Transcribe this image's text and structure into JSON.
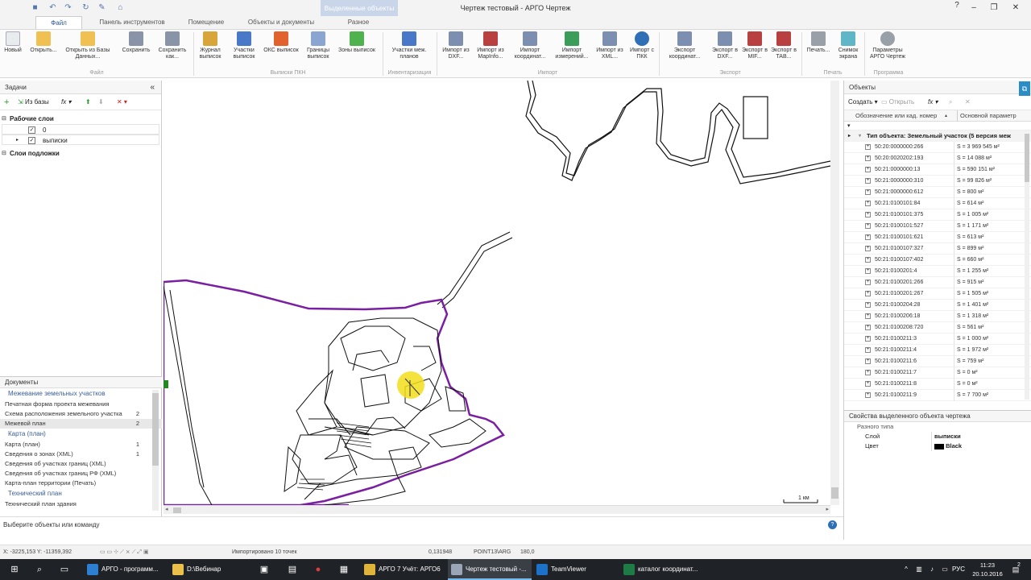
{
  "window": {
    "title": "Чертеж тестовый - АРГО Чертеж",
    "context_tab": "Выделенные объекты"
  },
  "ribbon_tabs": [
    "Файл",
    "Панель инструментов",
    "Помещение",
    "Объекты и документы",
    "Разное"
  ],
  "ribbon": {
    "buttons": [
      {
        "label": "Новый"
      },
      {
        "label": "Открыть..."
      },
      {
        "label": "Открыть из Базы Данных..."
      },
      {
        "label": "Сохранить"
      },
      {
        "label": "Сохранить как..."
      },
      {
        "label": "Журнал выписок"
      },
      {
        "label": "Участки выписок"
      },
      {
        "label": "ОКС выписок"
      },
      {
        "label": "Границы выписок"
      },
      {
        "label": "Зоны выписок"
      },
      {
        "label": "Участки меж. планов"
      },
      {
        "label": "Импорт из DXF..."
      },
      {
        "label": "Импорт из MapInfo..."
      },
      {
        "label": "Импорт координат..."
      },
      {
        "label": "Импорт измерений..."
      },
      {
        "label": "Импорт из XML..."
      },
      {
        "label": "Импорт с ПКК"
      },
      {
        "label": "Экспорт координат..."
      },
      {
        "label": "Экспорт в DXF..."
      },
      {
        "label": "Экспорт в MIF..."
      },
      {
        "label": "Экспорт в TAB..."
      },
      {
        "label": "Печать..."
      },
      {
        "label": "Снимок экрана"
      },
      {
        "label": "Параметры АРГО Чертеж"
      }
    ],
    "groups": [
      "Файл",
      "Выписки ПКН",
      "Инвентаризация",
      "Импорт",
      "Экспорт",
      "Печать",
      "Программа"
    ]
  },
  "tasks_panel": {
    "title": "Задачи",
    "from_db": "Из базы",
    "work_layers": "Рабочие слои",
    "layers": [
      {
        "name": "0",
        "checked": true
      },
      {
        "name": "выписки",
        "checked": true
      }
    ],
    "base_layers": "Слои подложки"
  },
  "documents": {
    "title": "Документы",
    "sections": [
      {
        "title": "Межевание земельных участков",
        "items": [
          {
            "label": "Печатная форма проекта межевания",
            "count": ""
          },
          {
            "label": "Схема расположения земельного участка",
            "count": "2"
          },
          {
            "label": "Межевой план",
            "count": "2"
          }
        ]
      },
      {
        "title": "Карта (план)",
        "items": [
          {
            "label": "Карта (план)",
            "count": "1"
          },
          {
            "label": "Сведения о зонах (XML)",
            "count": "1"
          },
          {
            "label": "Сведения об участках границ (XML)",
            "count": ""
          },
          {
            "label": "Сведения об участках границ РФ (XML)",
            "count": ""
          },
          {
            "label": "Карта-план территории (Печать)",
            "count": ""
          }
        ]
      },
      {
        "title": "Технический план",
        "items": [
          {
            "label": "Технический план здания",
            "count": ""
          }
        ]
      }
    ]
  },
  "canvas": {
    "scale_label": "1 км",
    "accent": "#7a1fa2"
  },
  "objects_panel": {
    "title": "Объекты",
    "create": "Создать",
    "open": "Открыть",
    "col1": "Обозначение или кад. номер",
    "col2": "Основной параметр",
    "group": "Тип объекта: Земельный участок (5 версия меж",
    "rows": [
      {
        "code": "50:20:0000000:266",
        "value": "S = 3 969 545 м²"
      },
      {
        "code": "50:20:0020202:193",
        "value": "S = 14 088 м²"
      },
      {
        "code": "50:21:0000000:13",
        "value": "S = 590 151 м²"
      },
      {
        "code": "50:21:0000000:310",
        "value": "S = 99 826 м²"
      },
      {
        "code": "50:21:0000000:612",
        "value": "S = 800 м²"
      },
      {
        "code": "50:21:0100101:84",
        "value": "S = 614 м²"
      },
      {
        "code": "50:21:0100101:375",
        "value": "S = 1 005 м²"
      },
      {
        "code": "50:21:0100101:527",
        "value": "S = 1 171 м²"
      },
      {
        "code": "50:21:0100101:621",
        "value": "S = 613 м²"
      },
      {
        "code": "50:21:0100107:327",
        "value": "S = 899 м²"
      },
      {
        "code": "50:21:0100107:402",
        "value": "S = 660 м²"
      },
      {
        "code": "50:21:0100201:4",
        "value": "S = 1 255 м²"
      },
      {
        "code": "50:21:0100201:266",
        "value": "S = 915 м²"
      },
      {
        "code": "50:21:0100201:267",
        "value": "S = 1 505 м²"
      },
      {
        "code": "50:21:0100204:28",
        "value": "S = 1 401 м²"
      },
      {
        "code": "50:21:0100206:18",
        "value": "S = 1 318 м²"
      },
      {
        "code": "50:21:0100208:720",
        "value": "S = 561 м²"
      },
      {
        "code": "50:21:0100211:3",
        "value": "S = 1 000 м²"
      },
      {
        "code": "50:21:0100211:4",
        "value": "S = 1 972 м²"
      },
      {
        "code": "50:21:0100211:6",
        "value": "S = 759 м²"
      },
      {
        "code": "50:21:0100211:7",
        "value": "S = 0 м²"
      },
      {
        "code": "50:21:0100211:8",
        "value": "S = 0 м²"
      },
      {
        "code": "50:21:0100211:9",
        "value": "S = 7 700 м²"
      }
    ]
  },
  "properties": {
    "title": "Свойства выделенного объекта чертежа",
    "section": "Разного типа",
    "rows": [
      {
        "name": "Слой",
        "value": "выписки"
      },
      {
        "name": "Цвет",
        "value": "Black"
      }
    ]
  },
  "status": {
    "prompt": "Выберите объекты или команду",
    "coords": "X: -3225,153 Y: -11359,392",
    "message": "Импортировано 10 точек",
    "value1": "0,131948",
    "value2": "POINT13\\ARG",
    "value3": "180,0"
  },
  "taskbar": {
    "items": [
      {
        "label": "АРГО - программ..."
      },
      {
        "label": "D:\\Вебинар"
      },
      {
        "label": "АРГО 7 Учёт: АРГО6"
      },
      {
        "label": "Чертеж тестовый -..."
      },
      {
        "label": "TeamViewer"
      },
      {
        "label": "каталог координат..."
      }
    ],
    "lang": "РУС",
    "time": "11:23",
    "date": "20.10.2016",
    "notifications": "2"
  }
}
